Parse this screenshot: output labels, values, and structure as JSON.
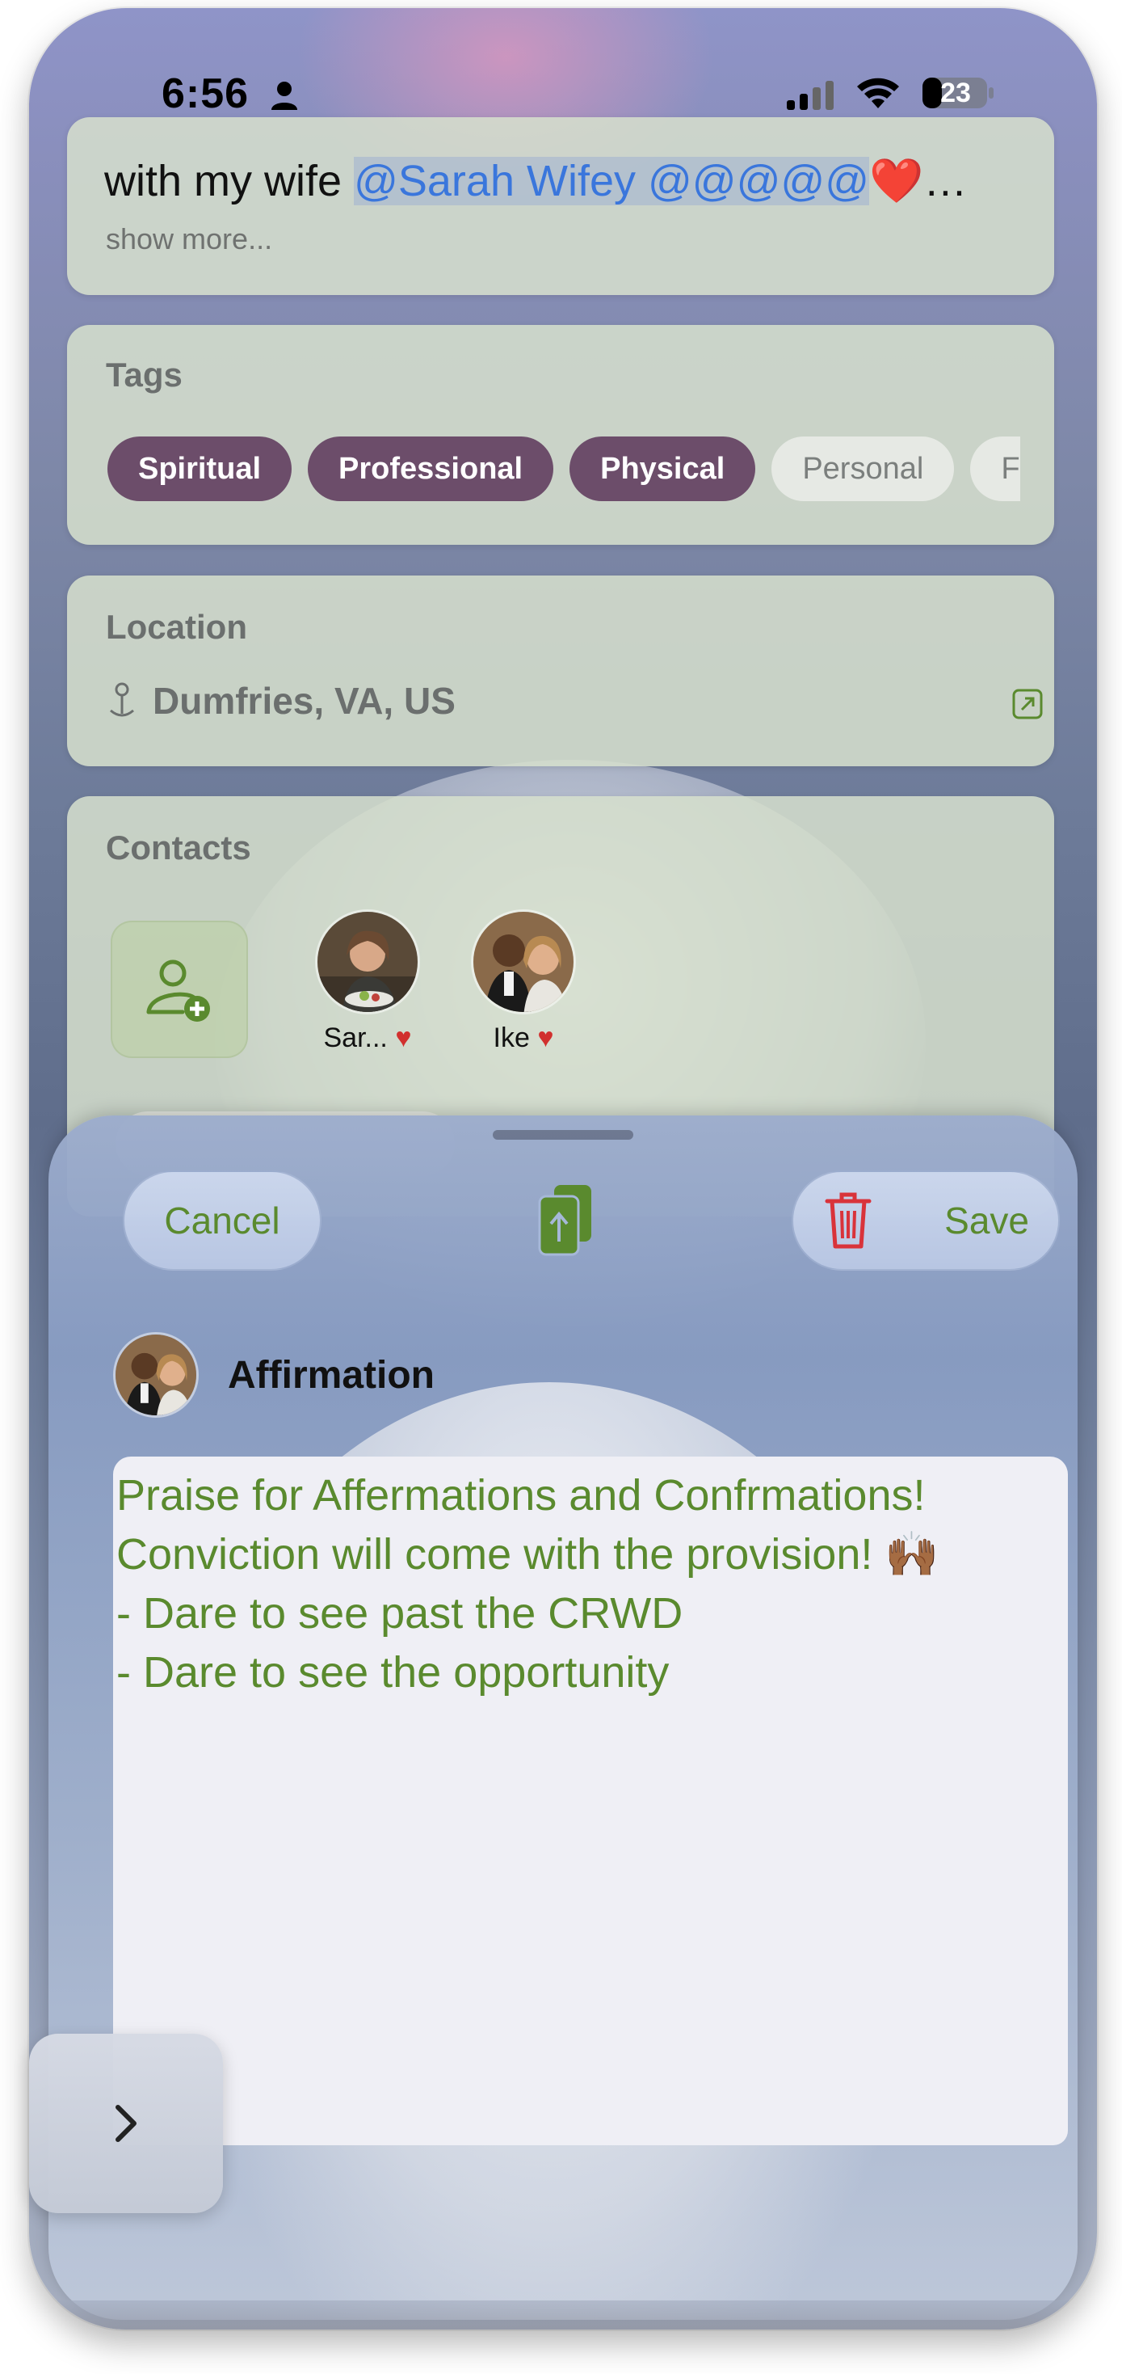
{
  "status_bar": {
    "time": "6:56",
    "battery": "23",
    "icons": [
      "person-icon",
      "cellular-signal-icon",
      "wifi-icon",
      "battery-icon"
    ]
  },
  "note": {
    "text_prefix": "with my wife ",
    "mention": "@Sarah Wifey @@@@@",
    "trailing": "…",
    "show_more": "show more..."
  },
  "tags": {
    "title": "Tags",
    "items": [
      {
        "label": "Spiritual",
        "selected": true
      },
      {
        "label": "Professional",
        "selected": true
      },
      {
        "label": "Physical",
        "selected": true
      },
      {
        "label": "Personal",
        "selected": false
      },
      {
        "label": "F",
        "selected": false
      }
    ]
  },
  "location": {
    "title": "Location",
    "value": "Dumfries, VA, US",
    "icons": [
      "map-pin-icon",
      "open-external-icon"
    ]
  },
  "contacts": {
    "title": "Contacts",
    "people": [
      {
        "name": "Sar...",
        "favorite": true
      },
      {
        "name": "Ike",
        "favorite": true
      }
    ],
    "icons": [
      "add-contact-icon"
    ]
  },
  "sheet": {
    "cancel_label": "Cancel",
    "save_label": "Save",
    "icons": [
      "share-upload-icon",
      "trash-icon",
      "chevron-right-icon"
    ],
    "entry_type": "Affirmation",
    "entry_text": "Praise for Affermations and Confrmations!\nConviction will come with the provision! 🙌🏾\n- Dare to see past the CRWD\n- Dare to see the opportunity"
  },
  "colors": {
    "accent_green": "#5a8a2e",
    "tag_selected": "#6c4d6a",
    "trash_red": "#d9333a",
    "heart_red": "#d1302e",
    "mention_blue": "#3a76dc"
  }
}
